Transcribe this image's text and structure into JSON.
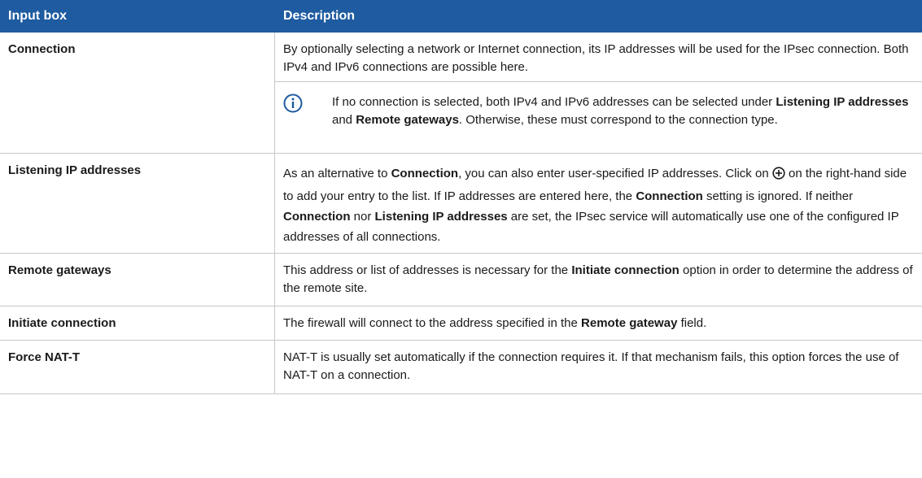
{
  "header": {
    "col1": "Input box",
    "col2": "Description"
  },
  "rows": {
    "connection": {
      "name": "Connection",
      "desc": "By optionally selecting a network or Internet connection, its IP addresses will be used for the IPsec connection. Both IPv4 and IPv6 connections are possible here.",
      "note": {
        "t1": "If no connection is selected, both IPv4 and IPv6 addresses can be selected under ",
        "b1": "Listening IP addresses",
        "t2": " and ",
        "b2": "Remote gateways",
        "t3": ". Otherwise, these must correspond to the connection type."
      }
    },
    "listening": {
      "name": "Listening IP addresses",
      "t1": "As an alternative to ",
      "b1": "Connection",
      "t2": ", you can also enter user-specified IP addresses. Click on ",
      "t3": " on the right-hand side to add your entry to the list. If IP addresses are entered here, the ",
      "b2": "Connection",
      "t4": " setting is ignored. If neither ",
      "b3": "Connection",
      "t5": " nor ",
      "b4": "Listening IP addresses",
      "t6": " are set, the IPsec service will automatically use one of the configured IP addresses of all connections."
    },
    "remote": {
      "name": "Remote gateways",
      "t1": "This address or list of addresses is necessary for the ",
      "b1": "Initiate connection",
      "t2": " option in order to determine the address of the remote site."
    },
    "initiate": {
      "name": "Initiate connection",
      "t1": "The firewall will connect to the address specified in the ",
      "b1": "Remote gateway",
      "t2": " field."
    },
    "nat": {
      "name": "Force NAT-T",
      "t1": "NAT-T is usually set automatically if the connection requires it. If that mechanism fails, this option forces the use of NAT-T on a connection."
    }
  },
  "icons": {
    "info": "info-icon",
    "add": "plus-circle-icon"
  },
  "colors": {
    "header_bg": "#1e5ba0",
    "header_text": "#ffffff",
    "icon": "#1e5ba0",
    "border": "#c8c8c8"
  }
}
